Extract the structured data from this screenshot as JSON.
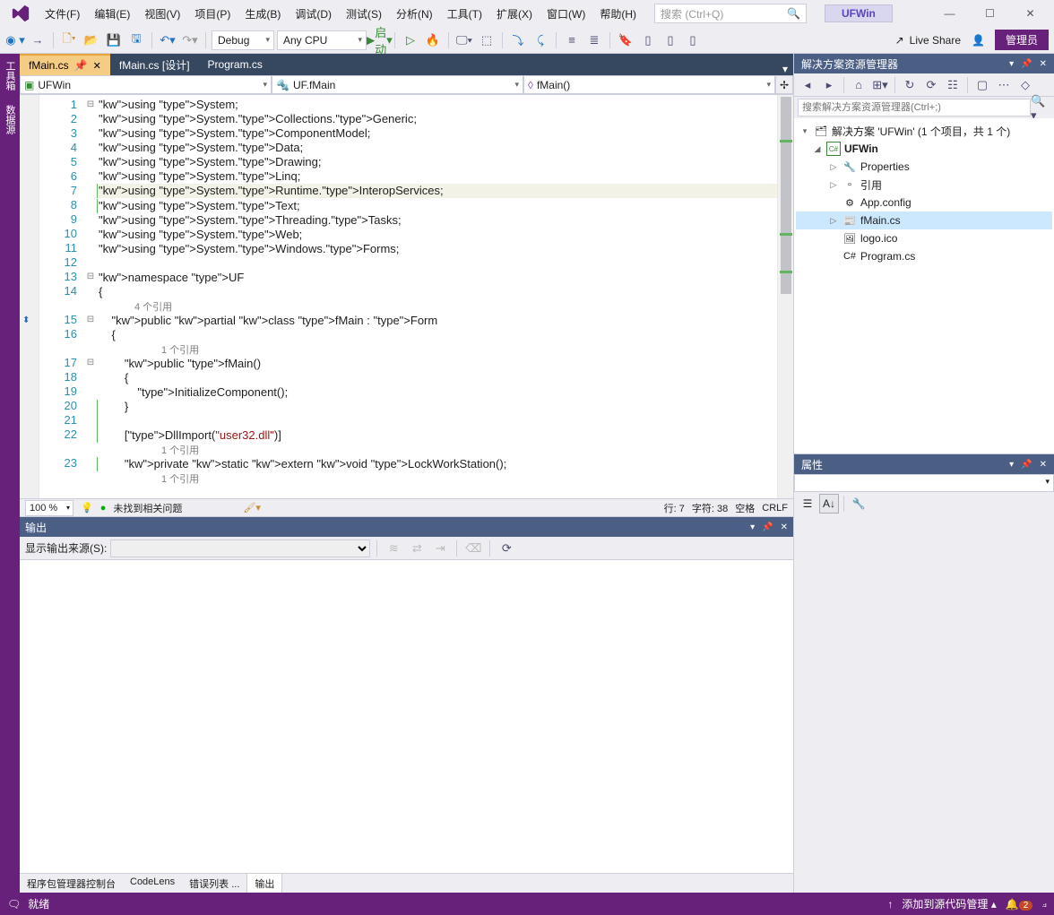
{
  "title_bar": {
    "menus": [
      "文件(F)",
      "编辑(E)",
      "视图(V)",
      "项目(P)",
      "生成(B)",
      "调试(D)",
      "测试(S)",
      "分析(N)",
      "工具(T)",
      "扩展(X)",
      "窗口(W)",
      "帮助(H)"
    ],
    "search_placeholder": "搜索 (Ctrl+Q)",
    "project": "UFWin"
  },
  "win_buttons": {
    "min": "—",
    "max": "☐",
    "close": "✕"
  },
  "toolbar": {
    "config": "Debug",
    "platform": "Any CPU",
    "start": "启动",
    "live_share": "Live Share",
    "admin": "管理员"
  },
  "side_tabs": [
    "工具箱",
    "数据源"
  ],
  "doc_tabs": [
    {
      "label": "fMain.cs",
      "active": true,
      "pinned": true
    },
    {
      "label": "fMain.cs [设计]",
      "active": false
    },
    {
      "label": "Program.cs",
      "active": false
    }
  ],
  "nav": {
    "scope": "UFWin",
    "class": "UF.fMain",
    "member": "fMain()"
  },
  "code": {
    "lines": [
      {
        "n": 1,
        "fold": "⊟",
        "t": "using System;"
      },
      {
        "n": 2,
        "t": "using System.Collections.Generic;"
      },
      {
        "n": 3,
        "t": "using System.ComponentModel;"
      },
      {
        "n": 4,
        "t": "using System.Data;"
      },
      {
        "n": 5,
        "t": "using System.Drawing;"
      },
      {
        "n": 6,
        "t": "using System.Linq;"
      },
      {
        "n": 7,
        "hl": true,
        "mark": "g",
        "t": "using System.Runtime.InteropServices;"
      },
      {
        "n": 8,
        "mark": "g",
        "t": "using System.Text;"
      },
      {
        "n": 9,
        "t": "using System.Threading.Tasks;"
      },
      {
        "n": 10,
        "t": "using System.Web;"
      },
      {
        "n": 11,
        "t": "using System.Windows.Forms;"
      },
      {
        "n": 12,
        "t": ""
      },
      {
        "n": 13,
        "fold": "⊟",
        "t": "namespace UF"
      },
      {
        "n": 14,
        "t": "{"
      },
      {
        "ref": "4 个引用"
      },
      {
        "n": 15,
        "fold": "⊟",
        "t": "    public partial class fMain : Form"
      },
      {
        "n": 16,
        "t": "    {"
      },
      {
        "ref": "1 个引用"
      },
      {
        "n": 17,
        "fold": "⊟",
        "t": "        public fMain()"
      },
      {
        "n": 18,
        "t": "        {"
      },
      {
        "n": 19,
        "t": "            InitializeComponent();"
      },
      {
        "n": 20,
        "mark": "g",
        "t": "        }"
      },
      {
        "n": 21,
        "mark": "g",
        "t": ""
      },
      {
        "n": 22,
        "mark": "g",
        "t": "        [DllImport(\"user32.dll\")]"
      },
      {
        "ref": "1 个引用"
      },
      {
        "n": 23,
        "mark": "g",
        "t": "        private static extern void LockWorkStation();"
      },
      {
        "ref": "1 个引用"
      }
    ]
  },
  "ed_status": {
    "zoom": "100 %",
    "issues": "未找到相关问题",
    "line": "行: 7",
    "col": "字符: 38",
    "ins": "空格",
    "eol": "CRLF"
  },
  "output": {
    "title": "输出",
    "from_label": "显示输出来源(S):",
    "bottom_tabs": [
      "程序包管理器控制台",
      "CodeLens",
      "错误列表 ...",
      "输出"
    ]
  },
  "sln": {
    "title": "解决方案资源管理器",
    "search_placeholder": "搜索解决方案资源管理器(Ctrl+;)",
    "root": "解决方案 'UFWin' (1 个项目，共 1 个)",
    "project": "UFWin",
    "items": [
      {
        "label": "Properties",
        "exp": "▷",
        "ico": "🔧"
      },
      {
        "label": "引用",
        "exp": "▷",
        "ico": "▫"
      },
      {
        "label": "App.config",
        "ico": "⚙"
      },
      {
        "label": "fMain.cs",
        "exp": "▷",
        "ico": "📰",
        "sel": true
      },
      {
        "label": "logo.ico",
        "ico": "🖼"
      },
      {
        "label": "Program.cs",
        "ico": "C#"
      }
    ]
  },
  "props": {
    "title": "属性"
  },
  "status": {
    "ready": "就绪",
    "scm": "添加到源代码管理",
    "notif": "2"
  }
}
